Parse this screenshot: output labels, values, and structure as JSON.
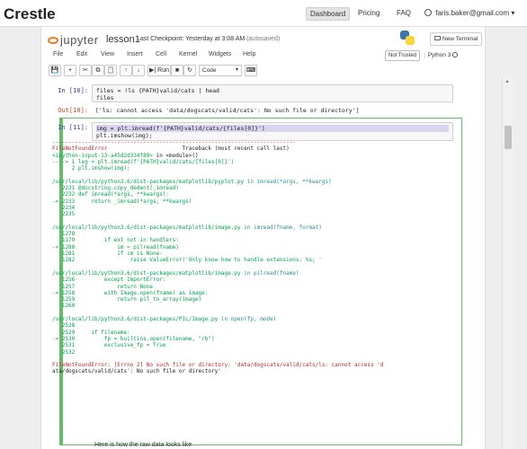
{
  "site": {
    "brand": "Crestle",
    "nav": {
      "dashboard": "Dashboard",
      "pricing": "Pricing",
      "faq": "FAQ",
      "user": "faris.baker@gmail.com",
      "user_caret": "▾"
    }
  },
  "notebook_header": {
    "logo_text": "jupyter",
    "notebook_name": "lesson1",
    "checkpoint": "Last Checkpoint: Yesterday at 3:08 AM",
    "autosaved": "(autosaved)",
    "new_terminal": "New Terminal"
  },
  "menu": {
    "items": [
      "File",
      "Edit",
      "View",
      "Insert",
      "Cell",
      "Kernel",
      "Widgets",
      "Help"
    ],
    "not_trusted": "Not Trusted",
    "kernel_name": "Python 3"
  },
  "toolbar": {
    "save": "💾",
    "add": "+",
    "cut": "✂",
    "copy": "⧉",
    "paste": "📋",
    "up": "↑",
    "down": "↓",
    "run": "▶| Run",
    "stop": "■",
    "restart": "↻",
    "fast_forward": "⏭",
    "cell_type": "Code",
    "keyboard": "⌨"
  },
  "cells": {
    "c1": {
      "prompt": "In [10]:",
      "line1": "files = !ls {PATH}valid/cats | head",
      "line2": "files"
    },
    "c1_out": {
      "prompt": "Out[10]:",
      "text": "['ls: cannot access 'data/dogscats/valid/cats': No such file or directory']"
    },
    "c2": {
      "prompt": "In [11]:",
      "line1": "img = plt.imread(f'{PATH}valid/cats/{files[0]}')",
      "line2": "plt.imshow(img);"
    }
  },
  "traceback": {
    "sep": "---------------------------------------------------------------------------",
    "error_name": "FileNotFoundError",
    "header_right": "Traceback (most recent call last)",
    "input_ref": "<ipython-input-13-a45d2d334f89>",
    "in_module": " in <module>()",
    "arrow1_line": "----> 1 leg = plt.imread(f'{PATH}valid/cats/{files[0]}')",
    "arrow1_line2": "      2 plt.imshow(img);",
    "f1_path": "/usr/local/lib/python3.6/dist-packages/matplotlib/pyplot.py",
    "f1_sig": " in imread(*args, **kwargs)",
    "f1_l1": "   2231 @docstring.copy_dedent(_imread)",
    "f1_l2": "   2232 def imread(*args, **kwargs):",
    "f1_l3": "-> 2233     return _imread(*args, **kwargs)",
    "f1_l4": "   2234",
    "f1_l5": "   2235",
    "f2_path": "/usr/local/lib/python3.6/dist-packages/matplotlib/image.py",
    "f2_sig": " in imread(fname, format)",
    "f2_l1": "   1278",
    "f2_l2": "   1279         if ext not in handlers:",
    "f2_l3": "-> 1280             im = pilread(fname)",
    "f2_l4": "   1281             if im is None:",
    "f2_l5": "   1282                 raise ValueError('Only know how to handle extensions: %s; '",
    "f3_path": "/usr/local/lib/python3.6/dist-packages/matplotlib/image.py",
    "f3_sig": " in pilread(fname)",
    "f3_l1": "   1256         except ImportError:",
    "f3_l2": "   1257             return None",
    "f3_l3": "-> 1258         with Image.open(fname) as image:",
    "f3_l4": "   1259             return pil_to_array(image)",
    "f3_l5": "   1260",
    "f4_path": "/usr/local/lib/python3.6/dist-packages/PIL/Image.py",
    "f4_sig": " in open(fp, mode)",
    "f4_l1": "   2528",
    "f4_l2": "   2529     if filename:",
    "f4_l3": "-> 2530         fp = builtins.open(filename, \"rb\")",
    "f4_l4": "   2531         exclusive_fp = True",
    "f4_l5": "   2532",
    "final1": "FileNotFoundError: [Errno 2] No such file or directory: 'data/dogscats/valid/cats/ls: cannot access 'd",
    "final2": "ata/dogscats/valid/cats': No such file or directory'"
  },
  "markdown": {
    "text": "Here is how the raw data looks like"
  },
  "colors": {
    "selected_border": "#66bb6a",
    "highlight": "#d9d4ef",
    "error_red": "#b22b31",
    "prompt_in": "#303f9f",
    "prompt_out": "#d84315"
  }
}
